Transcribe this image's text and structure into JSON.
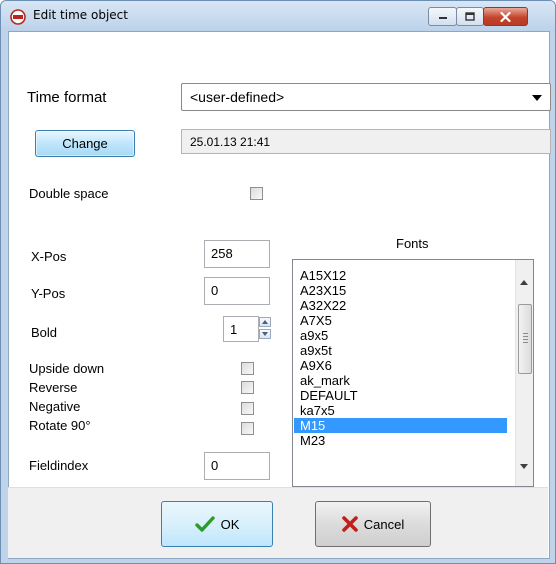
{
  "window": {
    "title": "Edit time object",
    "controls": {
      "minimize": "minimize-icon",
      "maximize": "maximize-icon",
      "close": "close-icon"
    }
  },
  "time_format": {
    "label": "Time format",
    "selected": "<user-defined>"
  },
  "change_button": "Change",
  "preview_value": "25.01.13 21:41",
  "double_space": {
    "label": "Double space",
    "checked": false
  },
  "fields": {
    "xpos": {
      "label": "X-Pos",
      "value": "258"
    },
    "ypos": {
      "label": "Y-Pos",
      "value": "0"
    },
    "bold": {
      "label": "Bold",
      "value": "1"
    },
    "fieldindex": {
      "label": "Fieldindex",
      "value": "0"
    }
  },
  "checkboxes": [
    {
      "label": "Upside down",
      "checked": false
    },
    {
      "label": "Reverse",
      "checked": false
    },
    {
      "label": "Negative",
      "checked": false
    },
    {
      "label": "Rotate 90°",
      "checked": false
    }
  ],
  "fonts": {
    "heading": "Fonts",
    "items": [
      "A15X12",
      "A23X15",
      "A32X22",
      "A7X5",
      "a9x5",
      "a9x5t",
      "A9X6",
      "ak_mark",
      "DEFAULT",
      "ka7x5",
      "M15",
      "M23"
    ],
    "selected": "M15"
  },
  "buttons": {
    "ok": "OK",
    "cancel": "Cancel"
  },
  "colors": {
    "selection": "#3399ff",
    "ok_icon": "#2e9a2e",
    "cancel_icon": "#c0201a",
    "window_frame": "#bfd3ea"
  }
}
